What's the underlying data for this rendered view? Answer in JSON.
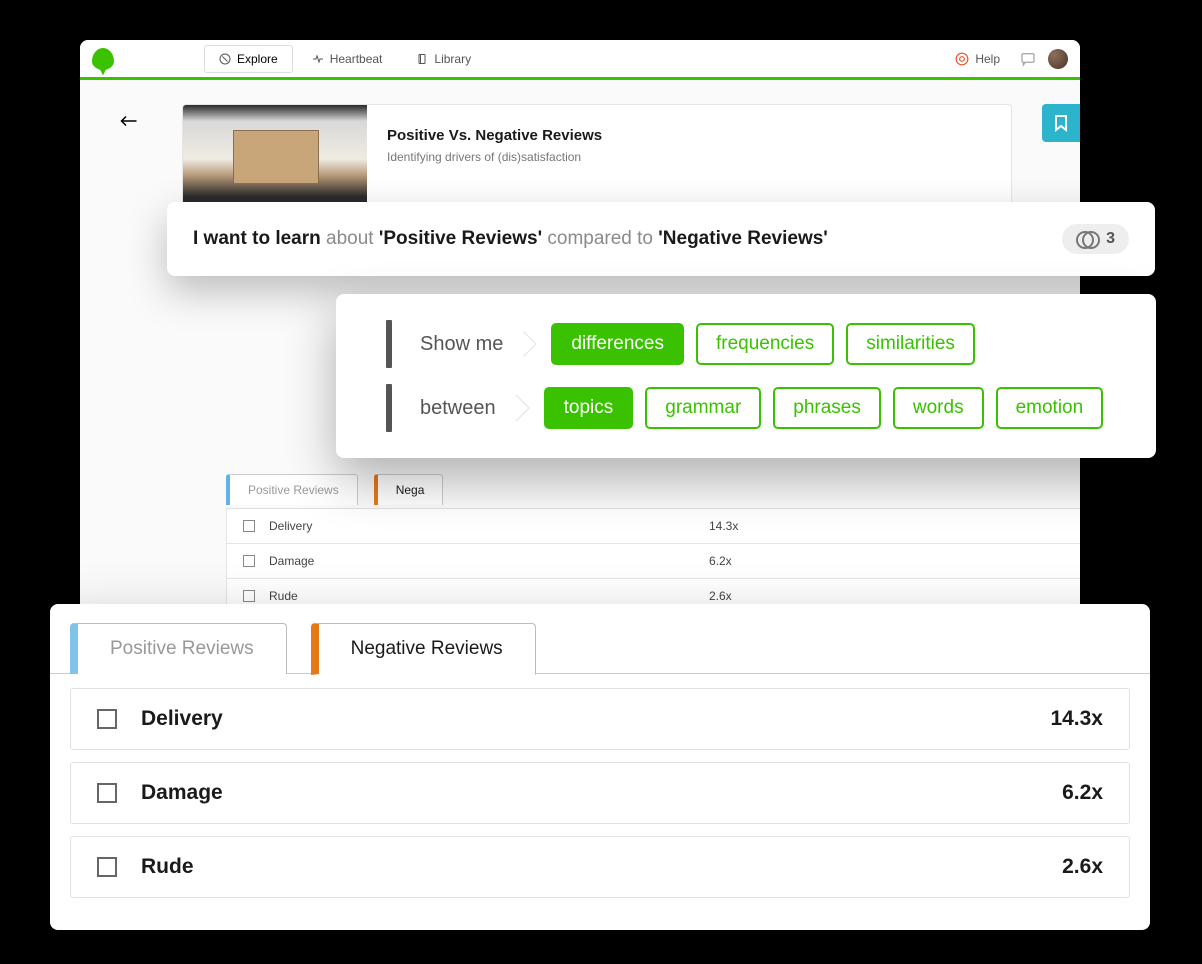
{
  "nav": {
    "tabs": [
      {
        "icon": "compass",
        "label": "Explore",
        "active": true
      },
      {
        "icon": "activity",
        "label": "Heartbeat",
        "active": false
      },
      {
        "icon": "book",
        "label": "Library",
        "active": false
      }
    ],
    "help": "Help"
  },
  "header": {
    "title": "Positive Vs. Negative Reviews",
    "subtitle": "Identifying drivers of (dis)satisfaction"
  },
  "learn": {
    "prefix": "I want to learn ",
    "about": "about ",
    "subject": "'Positive Reviews'",
    "middle": " compared to ",
    "object": "'Negative Reviews'",
    "filter_count": "3"
  },
  "query": {
    "row1_prompt": "Show me",
    "row1_chips": [
      {
        "label": "differences",
        "selected": true
      },
      {
        "label": "frequencies",
        "selected": false
      },
      {
        "label": "similarities",
        "selected": false
      }
    ],
    "row2_prompt": "between",
    "row2_chips": [
      {
        "label": "topics",
        "selected": true
      },
      {
        "label": "grammar",
        "selected": false
      },
      {
        "label": "phrases",
        "selected": false
      },
      {
        "label": "words",
        "selected": false
      },
      {
        "label": "emotion",
        "selected": false
      }
    ]
  },
  "tabs_small": {
    "positive": "Positive Reviews",
    "negative": "Negative Reviews",
    "negative_truncated": "Nega"
  },
  "rows": [
    {
      "label": "Delivery",
      "value": "14.3x"
    },
    {
      "label": "Damage",
      "value": "6.2x"
    },
    {
      "label": "Rude",
      "value": "2.6x"
    }
  ]
}
